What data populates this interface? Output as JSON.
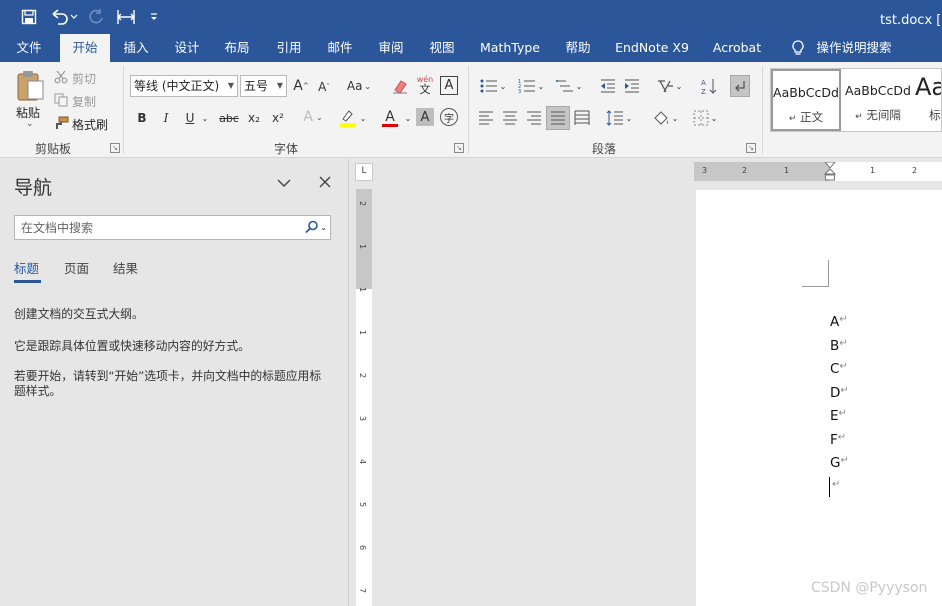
{
  "titlebar": {
    "doc_title": "tst.docx [兼",
    "qat": [
      {
        "name": "save-icon",
        "interactable": true
      },
      {
        "name": "undo-icon",
        "interactable": true
      },
      {
        "name": "redo-icon",
        "interactable": true
      },
      {
        "name": "page-width-icon",
        "interactable": true
      },
      {
        "name": "customize-qat-icon",
        "interactable": true
      }
    ]
  },
  "tabs": [
    {
      "label": "文件",
      "active": false
    },
    {
      "label": "开始",
      "active": true
    },
    {
      "label": "插入",
      "active": false
    },
    {
      "label": "设计",
      "active": false
    },
    {
      "label": "布局",
      "active": false
    },
    {
      "label": "引用",
      "active": false
    },
    {
      "label": "邮件",
      "active": false
    },
    {
      "label": "审阅",
      "active": false
    },
    {
      "label": "视图",
      "active": false
    },
    {
      "label": "MathType",
      "active": false
    },
    {
      "label": "帮助",
      "active": false
    },
    {
      "label": "EndNote X9",
      "active": false
    },
    {
      "label": "Acrobat",
      "active": false
    }
  ],
  "tell_me": {
    "label": "操作说明搜索"
  },
  "ribbon": {
    "clipboard": {
      "group_label": "剪贴板",
      "paste": "粘贴",
      "cut": "剪切",
      "copy": "复制",
      "format_painter": "格式刷"
    },
    "font": {
      "group_label": "字体",
      "font_name": "等线 (中文正文)",
      "font_size": "五号",
      "change_case": "Aa",
      "phonetic_top": "wén",
      "phonetic_bottom": "文",
      "bold": "B",
      "italic": "I",
      "underline": "U",
      "strikethrough": "abc",
      "subscript": "x₂",
      "superscript": "x²",
      "text_effects": "A",
      "font_color": "A",
      "char_shading": "A",
      "enclose_char": "字"
    },
    "paragraph": {
      "group_label": "段落"
    },
    "styles": [
      {
        "sample": "AaBbCcDd",
        "name": "正文"
      },
      {
        "sample": "AaBbCcDd",
        "name": "无间隔"
      },
      {
        "sample": "Aa",
        "name": "标"
      }
    ],
    "accent": "#2b579a"
  },
  "nav": {
    "title": "导航",
    "search_placeholder": "在文档中搜索",
    "tabs": [
      {
        "label": "标题",
        "active": true
      },
      {
        "label": "页面",
        "active": false
      },
      {
        "label": "结果",
        "active": false
      }
    ],
    "messages": [
      "创建文档的交互式大纲。",
      "它是跟踪具体位置或快速移动内容的好方式。",
      "若要开始，请转到“开始”选项卡，并向文档中的标题应用标题样式。"
    ]
  },
  "ruler": {
    "horizontal_labels": [
      "3",
      "2",
      "1",
      "1",
      "2"
    ],
    "vertical_labels": [
      "2",
      "1",
      "1",
      "1",
      "2",
      "3",
      "4",
      "5",
      "6",
      "7"
    ],
    "tab_selector": "L"
  },
  "document": {
    "paragraphs": [
      "A",
      "B",
      "C",
      "D",
      "E",
      "F",
      "G"
    ],
    "pilcrow": "↵"
  },
  "watermark": "CSDN @Pyyyson"
}
